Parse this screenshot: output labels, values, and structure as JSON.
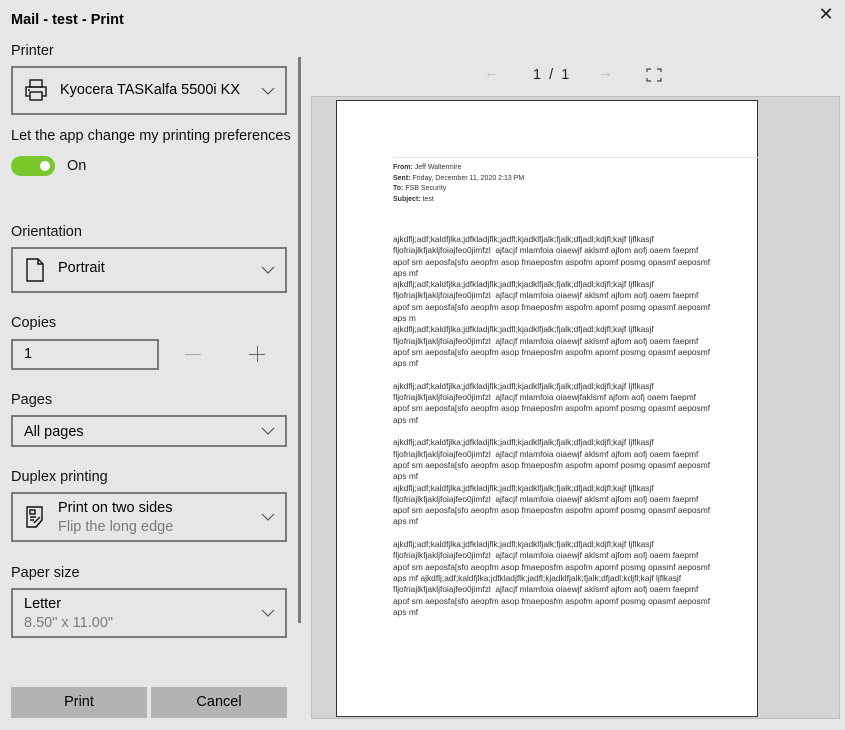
{
  "window": {
    "title": "Mail - test - Print",
    "close_icon": "close-icon"
  },
  "settings": {
    "printer_label": "Printer",
    "printer_value": "Kyocera TASKalfa 5500i KX",
    "preferences_label": "Let the app change my printing preferences",
    "preferences_toggle": "On",
    "preferences_on": true,
    "orientation_label": "Orientation",
    "orientation_value": "Portrait",
    "copies_label": "Copies",
    "copies_value": "1",
    "pages_label": "Pages",
    "pages_value": "All pages",
    "duplex_label": "Duplex printing",
    "duplex_value": "Print on two sides",
    "duplex_sub": "Flip the long edge",
    "paper_label": "Paper size",
    "paper_value": "Letter",
    "paper_sub": "8.50\" x 11.00\""
  },
  "buttons": {
    "print": "Print",
    "cancel": "Cancel"
  },
  "preview": {
    "current_page": "1",
    "separator": "/",
    "total_pages": "1",
    "email": {
      "from_label": "From:",
      "from": " Jeff Waltermire",
      "sent_label": "Sent:",
      "sent": " Friday, December 11, 2020 2:13 PM",
      "to_label": "To:",
      "to": " FSB Security",
      "subject_label": "Subject:",
      "subject": " test"
    },
    "lines": [
      "ajkdflj;adf;kaldfjlka;jdfkladjflk;jadfl;kjadklfjalk;fjalk;dfjadl;kdjfl;kajf ljflkasjf",
      "fljofriajlkfjakljfoiajfeo0jimfzl  ajfacjf mlamfoia oiaewjf aklsmf ajfom aofj oaem faepmf",
      "apof sm aeposfa[sfo aeopfm asop fmaeposfm aspofm apomf posmg opasmf aeposmf",
      "aps mf",
      "ajkdflj;adf;kaldfjlka;jdfkladjflk;jadfl;kjadklfjalk;fjalk;dfjadl;kdjfl;kajf ljflkasjf",
      "fljofriajlkfjakljfoiajfeo0jimfzl  ajfacjf mlamfoia oiaewjf aklsmf ajfom aofj oaem faepmf",
      "apof sm aeposfa[sfo aeopfm asop fmaeposfm aspofm apomf posmg opasmf aeposmf",
      "aps m",
      "ajkdflj;adf;kaldfjlka;jdfkladjflk;jadfl;kjadklfjalk;fjalk;dfjadl;kdjfl;kajf ljflkasjf",
      "fljofriajlkfjakljfoiajfeo0jimfzl  ajfacjf mlamfoia oiaewjf aklsmf ajfom aofj oaem faepmf",
      "apof sm aeposfa[sfo aeopfm asop fmaeposfm aspofm apomf posmg opasmf aeposmf",
      "aps mf",
      "",
      "ajkdflj;adf;kaldfjlka;jdfkladjflk;jadfl;kjadklfjalk;fjalk;dfjadl;kdjfl;kajf ljflkasjf",
      "fljofriajlkfjakljfoiajfeo0jimfzl  ajfacjf mlamfoia oiaewjfaklsmf ajfom aofj oaem faepmf",
      "apof sm aeposfa[sfo aeopfm asop fmaeposfm aspofm apomf posmg opasmf aeposmf",
      "aps mf",
      "",
      "ajkdflj;adf;kaldfjlka;jdfkladjflk;jadfl;kjadklfjalk;fjalk;dfjadl;kdjfl;kajf ljflkasjf",
      "fljofriajlkfjakljfoiajfeo0jimfzl  ajfacjf mlamfoia oiaewjf aklsmf ajfom aofj oaem faepmf",
      "apof sm aeposfa[sfo aeopfm asop fmaeposfm aspofm apomf posmg opasmf aeposmf",
      "aps mf",
      "ajkdflj;adf;kaldfjlka;jdfkladjflk;jadfl;kjadklfjalk;fjalk;dfjadl;kdjfl;kajf ljflkasjf",
      "fljofriajlkfjakljfoiajfeo0jimfzl  ajfacjf mlamfoia oiaewjf aklsmf ajfom aofj oaem faepmf",
      "apof sm aeposfa[sfo aeopfm asop fmaeposfm aspofm apomf posmg opasmf aeposmf",
      "aps mf",
      "",
      "ajkdflj;adf;kaldfjlka;jdfkladjflk;jadfl;kjadklfjalk;fjalk;dfjadl;kdjfl;kajf ljflkasjf",
      "fljofriajlkfjakljfoiajfeo0jimfzl  ajfacjf mlamfoia oiaewjf aklsmf ajfom aofj oaem faepmf",
      "apof sm aeposfa[sfo aeopfm asop fmaeposfm aspofm apomf posmg opasmf aeposmf",
      "aps mf ajkdflj;adf;kaldfjlka;jdfkladjflk;jadfl;kjadklfjalk;fjalk;dfjadl;kdjfl;kajf ljflkasjf",
      "fljofriajlkfjakljfoiajfeo0jimfzl  ajfacjf mlamfoia oiaewjf aklsmf ajfom aofj oaem faepmf",
      "apof sm aeposfa[sfo aeopfm asop fmaeposfm aspofm apomf posmg opasmf aeposmf",
      "aps mf"
    ]
  }
}
